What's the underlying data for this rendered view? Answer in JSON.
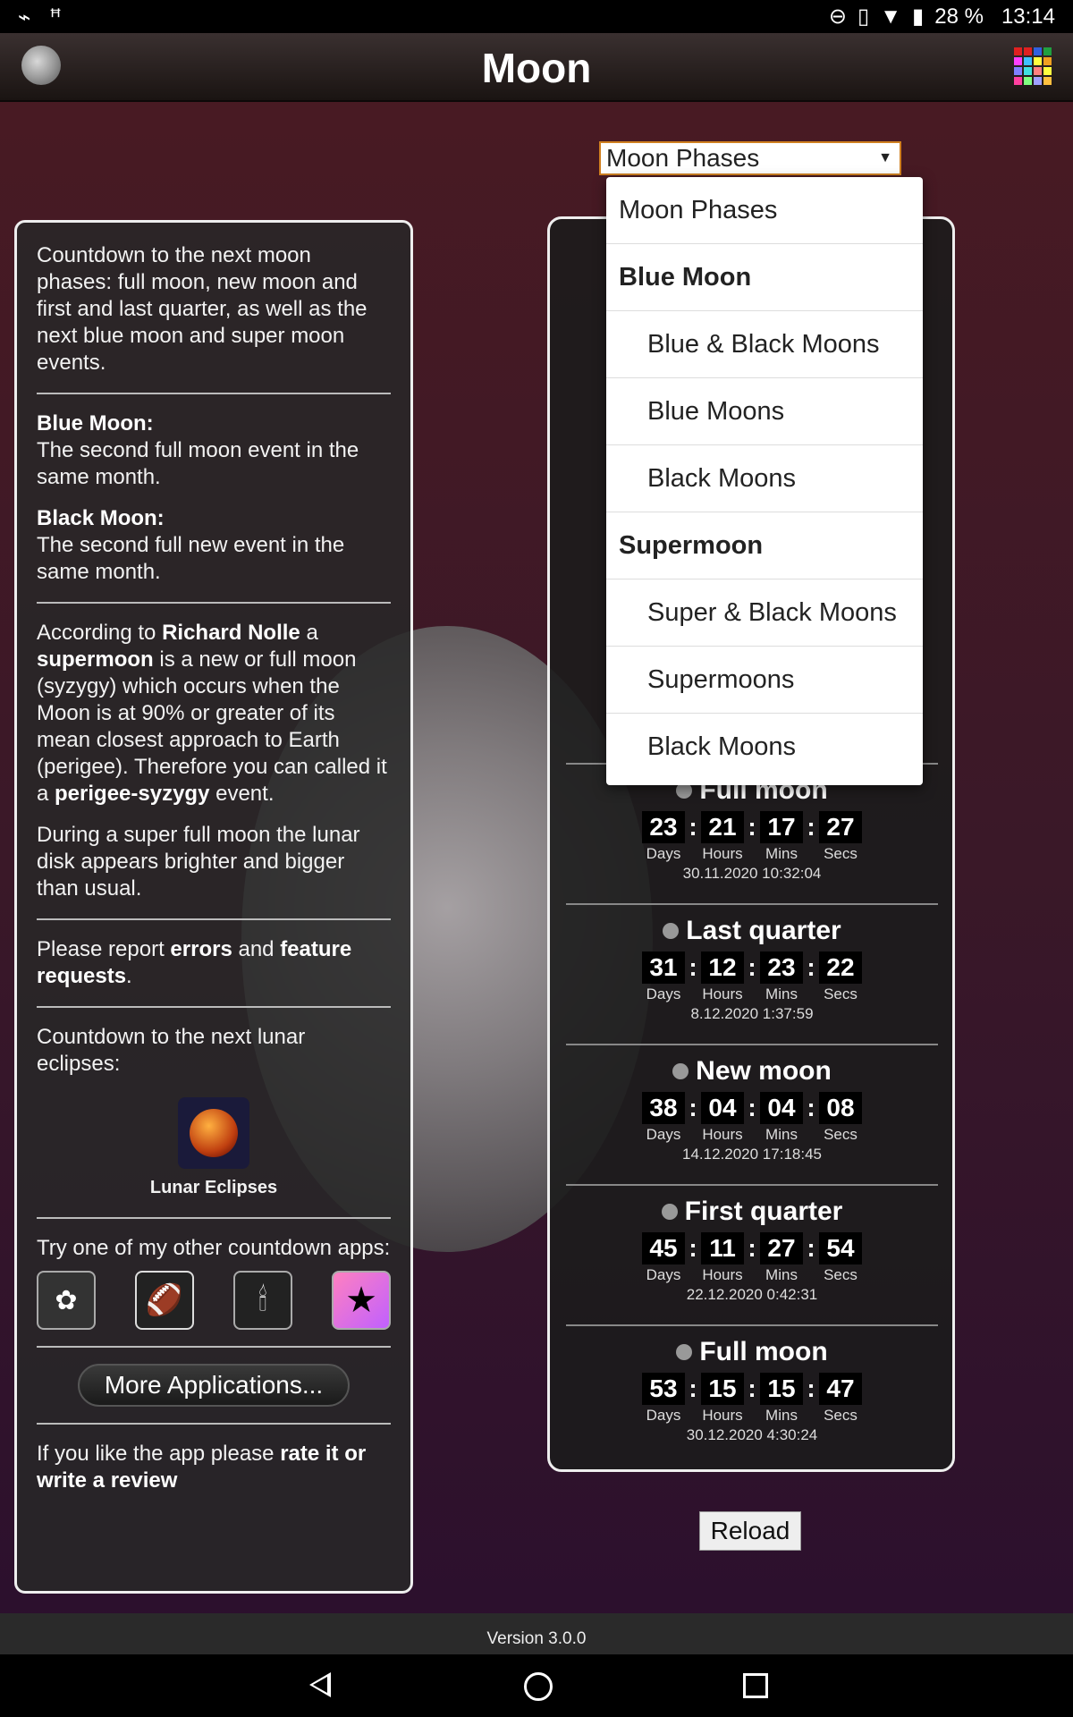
{
  "status_bar": {
    "left_icons": [
      "usb-icon",
      "debug-icon"
    ],
    "battery": "28 %",
    "time": "13:14"
  },
  "app": {
    "title": "Moon"
  },
  "select": {
    "value": "Moon Phases",
    "options": [
      {
        "label": "Moon Phases",
        "kind": "option"
      },
      {
        "label": "Blue Moon",
        "kind": "group"
      },
      {
        "label": "Blue & Black Moons",
        "kind": "indent"
      },
      {
        "label": "Blue Moons",
        "kind": "indent"
      },
      {
        "label": "Black Moons",
        "kind": "indent"
      },
      {
        "label": "Supermoon",
        "kind": "group"
      },
      {
        "label": "Super & Black Moons",
        "kind": "indent"
      },
      {
        "label": "Supermoons",
        "kind": "indent"
      },
      {
        "label": "Black Moons",
        "kind": "indent"
      }
    ]
  },
  "left": {
    "intro": "Countdown to the next moon phases: full moon, new moon and first and last quarter, as well as the next blue moon and super moon events.",
    "blue_title": "Blue Moon:",
    "blue_text": "The second full moon event in the same month.",
    "black_title": "Black Moon:",
    "black_text": "The second full new event in the same month.",
    "p3_a": "According to ",
    "p3_b": "Richard Nolle",
    "p3_c": " a ",
    "p3_d": "supermoon",
    "p3_e": " is a new or full moon (syzygy) which occurs when the Moon is at 90% or greater of its mean closest approach to Earth (perigee). Therefore you can called it a ",
    "p3_f": "perigee-syzygy",
    "p3_g": " event.",
    "p4": "During a super full moon the lunar disk appears brighter and bigger than usual.",
    "report_a": "Please report ",
    "report_b": "errors",
    "report_c": " and ",
    "report_d": "feature requests",
    "report_e": ".",
    "eclipse_text": "Countdown to the next lunar eclipses:",
    "eclipse_label": "Lunar Eclipses",
    "other_text": "Try one of my other countdown apps:",
    "more_button": "More Applications...",
    "rate_a": "If you like the app please ",
    "rate_b": "rate it or write a review"
  },
  "events": [
    {
      "name": "Full moon",
      "days": "23",
      "hours": "21",
      "mins": "17",
      "secs": "27",
      "date": "30.11.2020  10:32:04"
    },
    {
      "name": "Last quarter",
      "days": "31",
      "hours": "12",
      "mins": "23",
      "secs": "22",
      "date": "8.12.2020  1:37:59"
    },
    {
      "name": "New moon",
      "days": "38",
      "hours": "04",
      "mins": "04",
      "secs": "08",
      "date": "14.12.2020  17:18:45"
    },
    {
      "name": "First quarter",
      "days": "45",
      "hours": "11",
      "mins": "27",
      "secs": "54",
      "date": "22.12.2020  0:42:31"
    },
    {
      "name": "Full moon",
      "days": "53",
      "hours": "15",
      "mins": "15",
      "secs": "47",
      "date": "30.12.2020  4:30:24"
    }
  ],
  "units": {
    "days": "Days",
    "hours": "Hours",
    "mins": "Mins",
    "secs": "Secs"
  },
  "reload": "Reload",
  "version": "Version 3.0.0",
  "colors": {
    "accent": "#d08020",
    "background_top": "#4a1a22",
    "background_bottom": "#2a0f2e"
  }
}
